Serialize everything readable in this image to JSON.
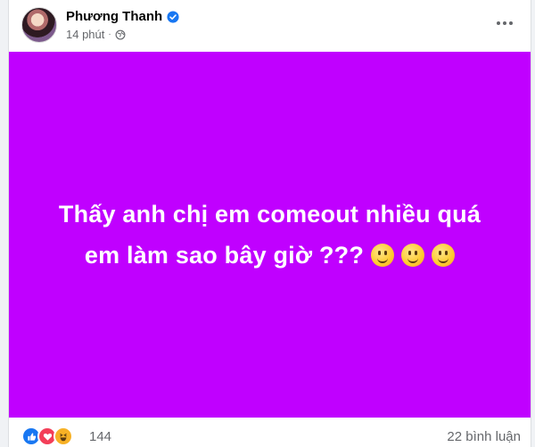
{
  "post": {
    "author": "Phương Thanh",
    "time": "14 phút",
    "separator": "·",
    "text_line1": "Thấy anh chị em comeout nhiều quá",
    "text_line2": "em làm sao bây giờ ???",
    "background_color": "#c000ff",
    "emojis": [
      "slightly-smiling-face",
      "slightly-smiling-face",
      "slightly-smiling-face"
    ]
  },
  "footer": {
    "reaction_icons": [
      "like-icon",
      "love-icon",
      "haha-icon"
    ],
    "reaction_count": "144",
    "comments_label": "22 bình luận"
  },
  "colors": {
    "verified": "#1877f2",
    "like": "#1877f2",
    "love": "#f33e58",
    "haha": "#f7b125"
  }
}
